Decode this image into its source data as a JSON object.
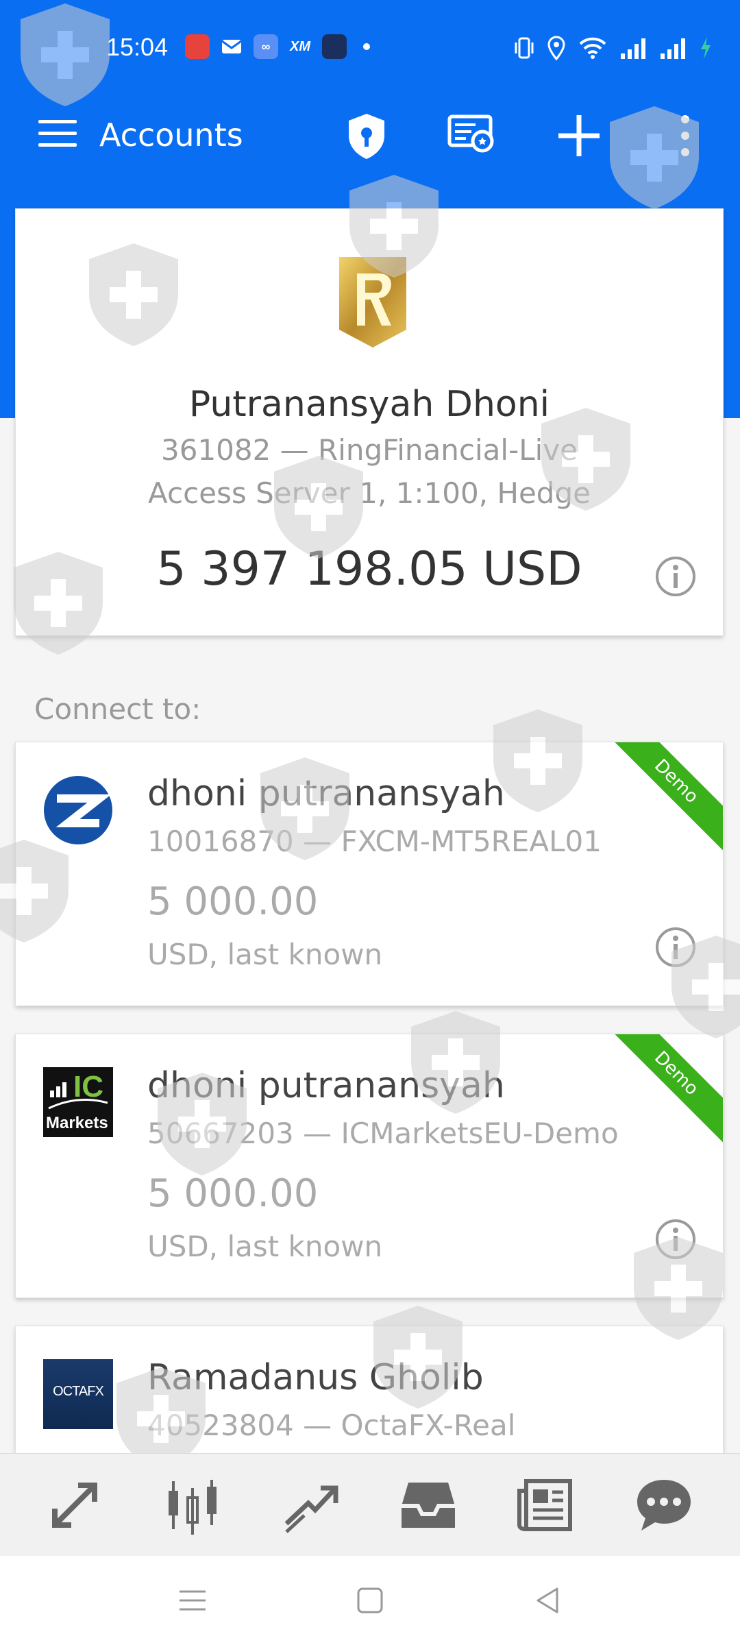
{
  "status_bar": {
    "time": "15:04",
    "notification_icons": [
      "app-icon",
      "mail-icon",
      "meta-icon",
      "xm-icon",
      "app-icon"
    ],
    "xm_label": "XM",
    "system_icons": [
      "vibrate-icon",
      "location-icon",
      "wifi-icon",
      "signal-icon",
      "signal-icon",
      "charging-icon"
    ]
  },
  "toolbar": {
    "title": "Accounts",
    "icons": [
      "menu-icon",
      "shield-key-icon",
      "certificate-icon",
      "add-icon",
      "more-vert-icon"
    ]
  },
  "current_account": {
    "name": "Putranansyah Dhoni",
    "server": "361082 — RingFinancial-Live",
    "details": "Access Server 1, 1:100, Hedge",
    "balance": "5 397 198.05 USD"
  },
  "connect_label": "Connect to:",
  "accounts": [
    {
      "name": "dhoni putranansyah",
      "server": "10016870 — FXCM-MT5REAL01",
      "balance": "5 000.00",
      "currency": "USD, last known",
      "badge": "Demo",
      "logo": "fxcm-logo"
    },
    {
      "name": "dhoni putranansyah",
      "server": "50667203 — ICMarketsEU-Demo",
      "balance": "5 000.00",
      "currency": "USD, last known",
      "badge": "Demo",
      "logo": "icmarkets-logo",
      "logo_text_top": "IC",
      "logo_text_bottom": "Markets"
    },
    {
      "name": "Ramadanus Gholib",
      "server": "40523804 — OctaFX-Real",
      "logo": "octafx-logo",
      "logo_text": "OCTAFX"
    }
  ],
  "bottom_nav": [
    "quotes-icon",
    "chart-icon",
    "trade-icon",
    "history-icon",
    "news-icon",
    "chat-icon"
  ],
  "system_nav": [
    "recents-icon",
    "home-icon",
    "back-icon"
  ],
  "colors": {
    "primary": "#0a6ef2",
    "demo_ribbon": "#3ab01a"
  }
}
